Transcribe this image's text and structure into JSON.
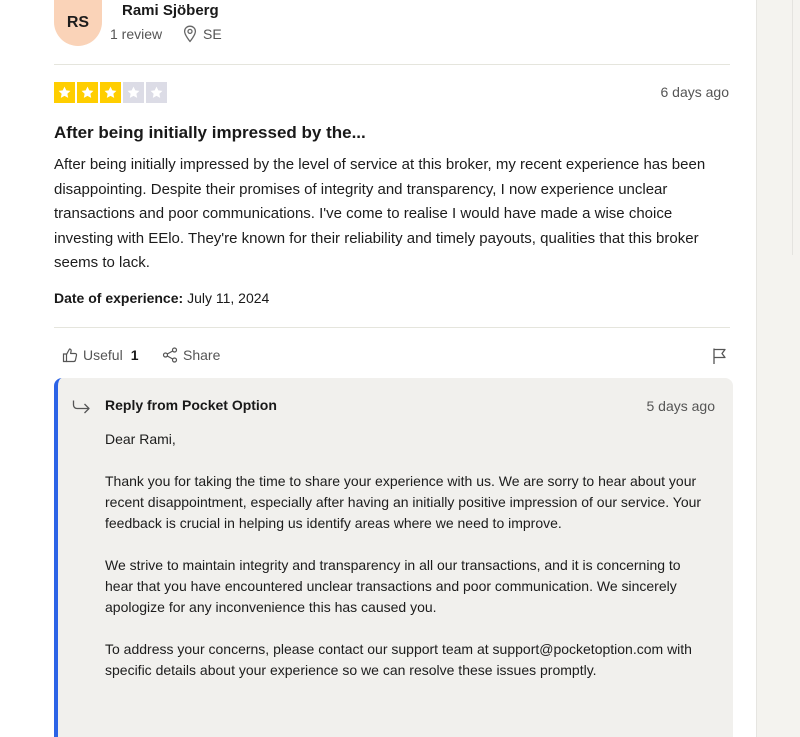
{
  "reviewer": {
    "initials": "RS",
    "name": "Rami Sjöberg",
    "review_count": "1 review",
    "country": "SE"
  },
  "review": {
    "rating": 3,
    "max_rating": 5,
    "date_ago": "6 days ago",
    "title": "After being initially impressed by the...",
    "body": "After being initially impressed by the level of service at this broker, my recent experience has been disappointing. Despite their promises of integrity and transparency, I now experience unclear transactions and poor communications. I've come to realise I would have made a wise choice investing with EElo. They're known for their reliability and timely payouts, qualities that this broker seems to lack.",
    "experience_label": "Date of experience:",
    "experience_date": "July 11, 2024"
  },
  "actions": {
    "useful_label": "Useful",
    "useful_count": "1",
    "share_label": "Share"
  },
  "reply": {
    "header": "Reply from Pocket Option",
    "date_ago": "5 days ago",
    "greeting": "Dear Rami,",
    "paragraph_1": "Thank you for taking the time to share your experience with us. We are sorry to hear about your recent disappointment, especially after having an initially positive impression of our service. Your feedback is crucial in helping us identify areas where we need to improve.",
    "paragraph_2": "We strive to maintain integrity and transparency in all our transactions, and it is concerning to hear that you have encountered unclear transactions and poor communication. We sincerely apologize for any inconvenience this has caused you.",
    "paragraph_3": "To address your concerns, please contact our support team at support@pocketoption.com with specific details about your experience so we can resolve these issues promptly."
  },
  "colors": {
    "star_filled": "#ffce00",
    "star_empty": "#dcdce6",
    "reply_accent": "#2c63e6",
    "avatar_bg": "#fad3b8"
  }
}
